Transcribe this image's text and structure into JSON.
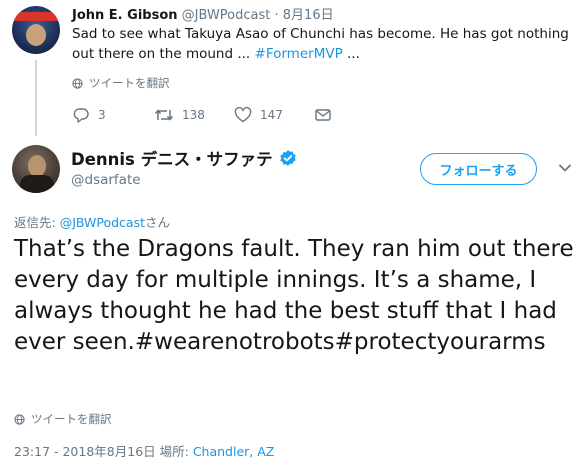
{
  "parent_tweet": {
    "display_name": "John E. Gibson",
    "handle": "@JBWPodcast",
    "separator": " · ",
    "date": "8月16日",
    "text": "Sad to see what Takuya Asao of Chunchi has become. He has got nothing out there on the mound ... ",
    "hashtag": "#FormerMVP",
    "ellipsis": " ...",
    "translate_label": "ツイートを翻訳",
    "actions": {
      "reply_count": "3",
      "retweet_count": "138",
      "like_count": "147"
    },
    "avatar_icon": "jbw-podcast-avatar"
  },
  "main_tweet": {
    "display_name": "Dennis デニス・サファテ",
    "verified_icon": "verified-badge-icon",
    "handle": "@dsarfate",
    "follow_label": "フォローする",
    "reply_prefix": "返信先: ",
    "reply_handle": "@JBWPodcast",
    "reply_suffix": "さん",
    "text": "That’s the Dragons fault. They ran him out there every day for multiple innings. It’s a shame, I always thought he had the best stuff that I had ever seen.",
    "hashtags": "#wearenotrobots#protectyourarms",
    "translate_label": "ツイートを翻訳",
    "timestamp": "23:17 - 2018年8月16日",
    "location_label": " 場所: ",
    "location": "Chandler, AZ"
  },
  "colors": {
    "accent": "#1da1f2",
    "link": "#1b95e0",
    "muted": "#657786",
    "text": "#14171a"
  }
}
